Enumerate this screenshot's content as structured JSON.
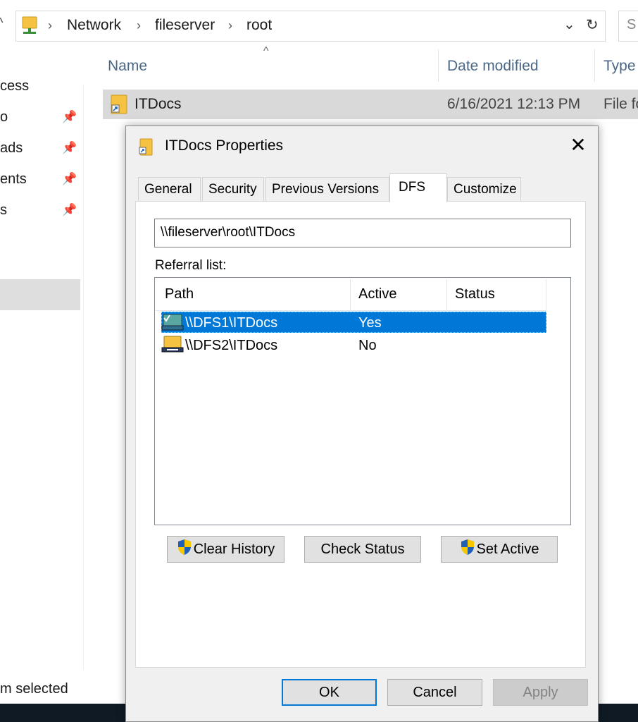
{
  "explorer": {
    "breadcrumb": [
      "Network",
      "fileserver",
      "root"
    ],
    "search_placeholder": "S",
    "columns": {
      "name": "Name",
      "date_modified": "Date modified",
      "type": "Type"
    },
    "file": {
      "name": "ITDocs",
      "date_modified": "6/16/2021 12:13 PM",
      "type": "File fo"
    },
    "nav_items": [
      "cess",
      "o",
      "ads",
      "ents",
      "s"
    ],
    "status": "m selected"
  },
  "dialog": {
    "title": "ITDocs Properties",
    "tabs": [
      "General",
      "Security",
      "Previous Versions",
      "DFS",
      "Customize"
    ],
    "active_tab": "DFS",
    "path_value": "\\\\fileserver\\root\\ITDocs",
    "referral_label": "Referral list:",
    "list_columns": {
      "path": "Path",
      "active": "Active",
      "status": "Status"
    },
    "referrals": [
      {
        "path": "\\\\DFS1\\ITDocs",
        "active": "Yes",
        "status": "",
        "selected": true
      },
      {
        "path": "\\\\DFS2\\ITDocs",
        "active": "No",
        "status": "",
        "selected": false
      }
    ],
    "buttons": {
      "clear_history": "Clear History",
      "check_status": "Check Status",
      "set_active": "Set Active",
      "ok": "OK",
      "cancel": "Cancel",
      "apply": "Apply"
    }
  },
  "colors": {
    "accent": "#0078d7",
    "folder": "#f5c242",
    "shield_blue": "#1f5fb4",
    "shield_yellow": "#f7c800"
  }
}
